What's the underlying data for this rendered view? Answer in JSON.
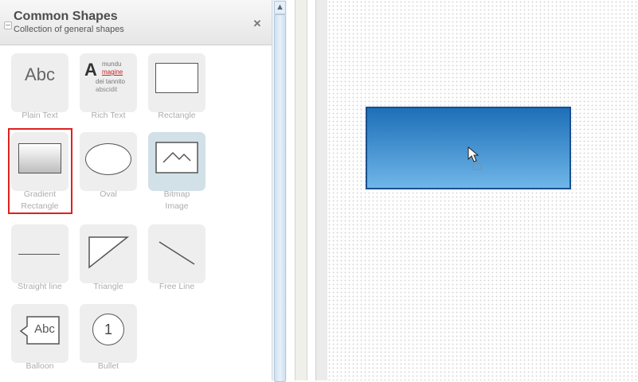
{
  "panel": {
    "title": "Common Shapes",
    "subtitle": "Collection of general shapes"
  },
  "shapes": [
    {
      "name": "plain-text",
      "label": "Plain Text",
      "icon_text": "Abc"
    },
    {
      "name": "rich-text",
      "label": "Rich Text",
      "icon_text": {
        "big": "A",
        "l1": "mundu",
        "l2": "magine",
        "l3": "dei tannito",
        "l4": "abscidit"
      }
    },
    {
      "name": "rectangle",
      "label": "Rectangle"
    },
    {
      "name": "gradient-rectangle",
      "label_line1": "Gradient",
      "label_line2": "Rectangle"
    },
    {
      "name": "oval",
      "label": "Oval"
    },
    {
      "name": "bitmap-image",
      "label_line1": "Bitmap",
      "label_line2": "Image"
    },
    {
      "name": "straight-line",
      "label": "Straight line"
    },
    {
      "name": "triangle",
      "label": "Triangle"
    },
    {
      "name": "free-line",
      "label": "Free Line"
    },
    {
      "name": "balloon",
      "label": "Balloon",
      "icon_text": "Abc"
    },
    {
      "name": "bullet",
      "label": "Bullet",
      "icon_text": "1"
    }
  ],
  "colors": {
    "highlight": "#e02020",
    "canvas_shape_top": "#1e6fb8",
    "canvas_shape_bottom": "#6fb6e8",
    "canvas_shape_border": "#1a4f8f"
  },
  "icons": [
    "collapse-icon",
    "close-icon",
    "scroll-up-arrow-icon",
    "mouse-pointer-icon",
    "move-icon"
  ]
}
